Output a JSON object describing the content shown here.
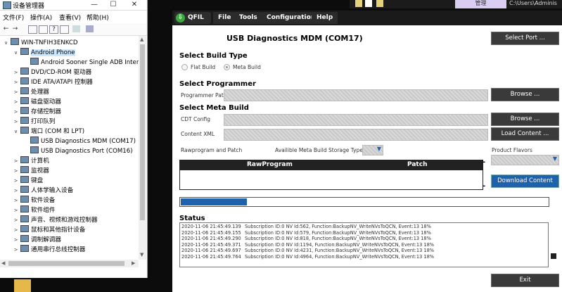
{
  "device_manager": {
    "title": "设备管理器",
    "menu": [
      "文件(F)",
      "操作(A)",
      "查看(V)",
      "帮助(H)"
    ],
    "tree": [
      {
        "label": "WIN-TNFIH3ENKCD",
        "indent": 0,
        "expander": "∨"
      },
      {
        "label": "Android Phone",
        "indent": 1,
        "expander": "∨",
        "selected": true
      },
      {
        "label": "Android Sooner Single ADB Interf",
        "indent": 2,
        "expander": ""
      },
      {
        "label": "DVD/CD-ROM 驱动器",
        "indent": 1,
        "expander": ">"
      },
      {
        "label": "IDE ATA/ATAPI 控制器",
        "indent": 1,
        "expander": ">"
      },
      {
        "label": "处理器",
        "indent": 1,
        "expander": ">"
      },
      {
        "label": "磁盘驱动器",
        "indent": 1,
        "expander": ">"
      },
      {
        "label": "存储控制器",
        "indent": 1,
        "expander": ">"
      },
      {
        "label": "打印队列",
        "indent": 1,
        "expander": ">"
      },
      {
        "label": "端口 (COM 和 LPT)",
        "indent": 1,
        "expander": "∨"
      },
      {
        "label": "USB Diagnostics MDM (COM17)",
        "indent": 2,
        "expander": ""
      },
      {
        "label": "USB Diagnostics Port (COM16)",
        "indent": 2,
        "expander": ""
      },
      {
        "label": "计算机",
        "indent": 1,
        "expander": ">"
      },
      {
        "label": "监视器",
        "indent": 1,
        "expander": ">"
      },
      {
        "label": "键盘",
        "indent": 1,
        "expander": ">"
      },
      {
        "label": "人体学输入设备",
        "indent": 1,
        "expander": ">"
      },
      {
        "label": "软件设备",
        "indent": 1,
        "expander": ">"
      },
      {
        "label": "软件组件",
        "indent": 1,
        "expander": ">"
      },
      {
        "label": "声音、视频和游戏控制器",
        "indent": 1,
        "expander": ">"
      },
      {
        "label": "鼠标和其他指针设备",
        "indent": 1,
        "expander": ">"
      },
      {
        "label": "调制解调器",
        "indent": 1,
        "expander": ">"
      },
      {
        "label": "通用串行总线控制器",
        "indent": 1,
        "expander": ">"
      }
    ]
  },
  "background": {
    "manage_label": "管理",
    "path_text": "C:\\Users\\Adminis"
  },
  "qfil": {
    "logo": "QFIL",
    "menu": [
      "File",
      "Tools",
      "Configuration",
      "Help"
    ],
    "port_title": "USB Diagnostics MDM (COM17)",
    "select_port_button": "Select Port ...",
    "build_type": {
      "heading": "Select Build Type",
      "options": [
        "Flat Build",
        "Meta Build"
      ],
      "selected": "Meta Build"
    },
    "programmer": {
      "heading": "Select Programmer",
      "path_label": "Programmer Path",
      "browse_button": "Browse ..."
    },
    "meta_build": {
      "heading": "Select Meta Build",
      "cdt_label": "CDT Config",
      "cdt_browse_button": "Browse ...",
      "content_xml_label": "Content XML",
      "load_content_button": "Load Content ...",
      "rawprogram_label": "Rawprogram and Patch",
      "storage_types_label": "Availible Meta Build Storage Types",
      "product_flavors_label": "Product Flavors"
    },
    "table": {
      "columns": [
        "RawProgram",
        "Patch"
      ]
    },
    "download_button": "Download Content",
    "dash_1": "-",
    "dash_2": "-",
    "progress": 0.18,
    "status": {
      "heading": "Status",
      "lines": [
        {
          "ts": "2020-11-06 21:45:49.139",
          "msg": "Subscription ID:0 NV Id:562, Function:BackupNV_WriteNVsToQCN, Event:13  18%"
        },
        {
          "ts": "2020-11-06 21:45:49.155",
          "msg": "Subscription ID:0 NV Id:579, Function:BackupNV_WriteNVsToQCN, Event:13  18%"
        },
        {
          "ts": "2020-11-06 21:45:49.290",
          "msg": "Subscription ID:0 NV Id:818, Function:BackupNV_WriteNVsToQCN, Event:13  18%"
        },
        {
          "ts": "2020-11-06 21:45:49.371",
          "msg": "Subscription ID:0 NV Id:1194, Function:BackupNV_WriteNVsToQCN, Event:13  18%"
        },
        {
          "ts": "2020-11-06 21:45:49.697",
          "msg": "Subscription ID:0 NV Id:4231, Function:BackupNV_WriteNVsToQCN, Event:13  18%"
        },
        {
          "ts": "2020-11-06 21:45:49.764",
          "msg": "Subscription ID:0 NV Id:4964, Function:BackupNV_WriteNVsToQCN, Event:13  18%"
        }
      ]
    },
    "exit_button": "Exit"
  }
}
